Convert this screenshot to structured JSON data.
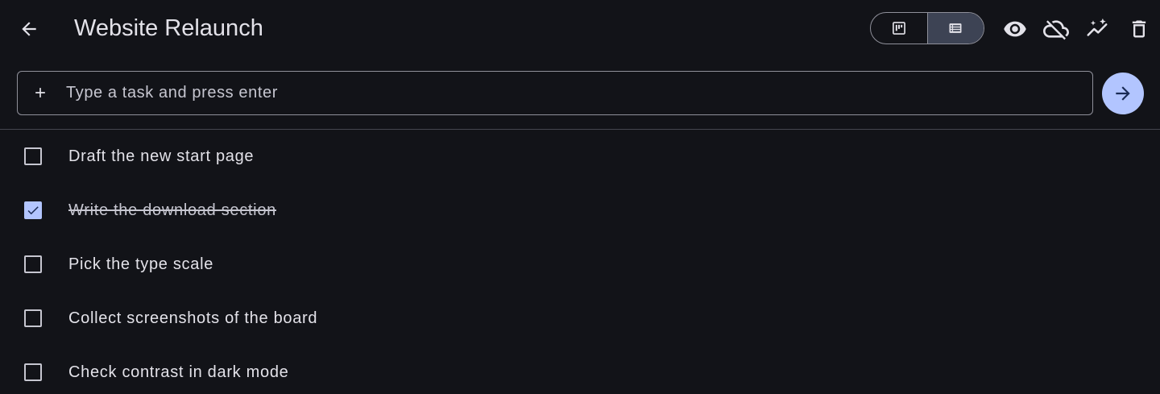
{
  "header": {
    "title": "Website Relaunch",
    "back_icon": "arrow-back-icon",
    "view_toggle": [
      {
        "icon": "board-view-icon",
        "active": false
      },
      {
        "icon": "list-view-icon",
        "active": true
      }
    ],
    "actions": [
      "visibility-icon",
      "cloud-off-icon",
      "auto-awesome-icon",
      "delete-icon"
    ]
  },
  "task_input": {
    "placeholder": "Type a task and press enter",
    "value": ""
  },
  "tasks": [
    {
      "label": "Draft the new start page",
      "done": false
    },
    {
      "label": "Write the download section",
      "done": true
    },
    {
      "label": "Pick the type scale",
      "done": false
    },
    {
      "label": "Collect screenshots of the board",
      "done": false
    },
    {
      "label": "Check contrast in dark mode",
      "done": false
    }
  ],
  "colors": {
    "background": "#121318",
    "text": "#e3e2e9",
    "outline": "#8f909a",
    "primary": "#b2c5ff",
    "active_segment": "#3d4354"
  }
}
